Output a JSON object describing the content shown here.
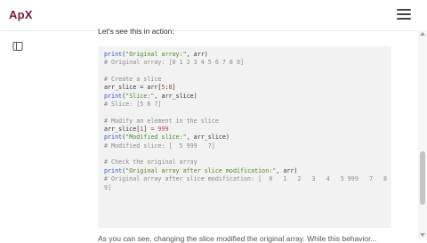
{
  "header": {
    "logo_text": "ApX",
    "menu_icon": "hamburger-menu-icon"
  },
  "sidebar": {
    "toggle_icon": "sidebar-toggle-icon"
  },
  "article": {
    "intro": "Let's see this in action:",
    "code_lines": [
      [
        {
          "t": "fn",
          "v": "print"
        },
        {
          "t": "p",
          "v": "("
        },
        {
          "t": "str",
          "v": "\"Original array:\""
        },
        {
          "t": "p",
          "v": ", arr)"
        }
      ],
      [
        {
          "t": "cm",
          "v": "# Original array: [0 1 2 3 4 5 6 7 8 9]"
        }
      ],
      [],
      [
        {
          "t": "cm",
          "v": "# Create a slice"
        }
      ],
      [
        {
          "t": "p",
          "v": "arr_slice = arr["
        },
        {
          "t": "num",
          "v": "5"
        },
        {
          "t": "p",
          "v": ":"
        },
        {
          "t": "num",
          "v": "8"
        },
        {
          "t": "p",
          "v": "]"
        }
      ],
      [
        {
          "t": "fn",
          "v": "print"
        },
        {
          "t": "p",
          "v": "("
        },
        {
          "t": "str",
          "v": "\"Slice:\""
        },
        {
          "t": "p",
          "v": ", arr_slice)"
        }
      ],
      [
        {
          "t": "cm",
          "v": "# Slice: [5 6 7]"
        }
      ],
      [],
      [
        {
          "t": "cm",
          "v": "# Modify an element in the slice"
        }
      ],
      [
        {
          "t": "p",
          "v": "arr_slice["
        },
        {
          "t": "num",
          "v": "1"
        },
        {
          "t": "p",
          "v": "] "
        },
        {
          "t": "op",
          "v": "="
        },
        {
          "t": "p",
          "v": " "
        },
        {
          "t": "num",
          "v": "999"
        }
      ],
      [
        {
          "t": "fn",
          "v": "print"
        },
        {
          "t": "p",
          "v": "("
        },
        {
          "t": "str",
          "v": "\"Modified slice:\""
        },
        {
          "t": "p",
          "v": ", arr_slice)"
        }
      ],
      [
        {
          "t": "cm",
          "v": "# Modified slice: [  5 999   7]"
        }
      ],
      [],
      [
        {
          "t": "cm",
          "v": "# Check the original array"
        }
      ],
      [
        {
          "t": "fn",
          "v": "print"
        },
        {
          "t": "p",
          "v": "("
        },
        {
          "t": "str",
          "v": "\"Original array after slice modification:\""
        },
        {
          "t": "p",
          "v": ", arr)"
        }
      ],
      [
        {
          "t": "cm",
          "v": "# Original array after slice modification: [  0   1   2   3   4   5 999   7   8"
        }
      ],
      [
        {
          "t": "cm",
          "v": "9]"
        }
      ]
    ],
    "bottom_text": "As you can see, changing the slice modified the original array. While this behavior..."
  }
}
